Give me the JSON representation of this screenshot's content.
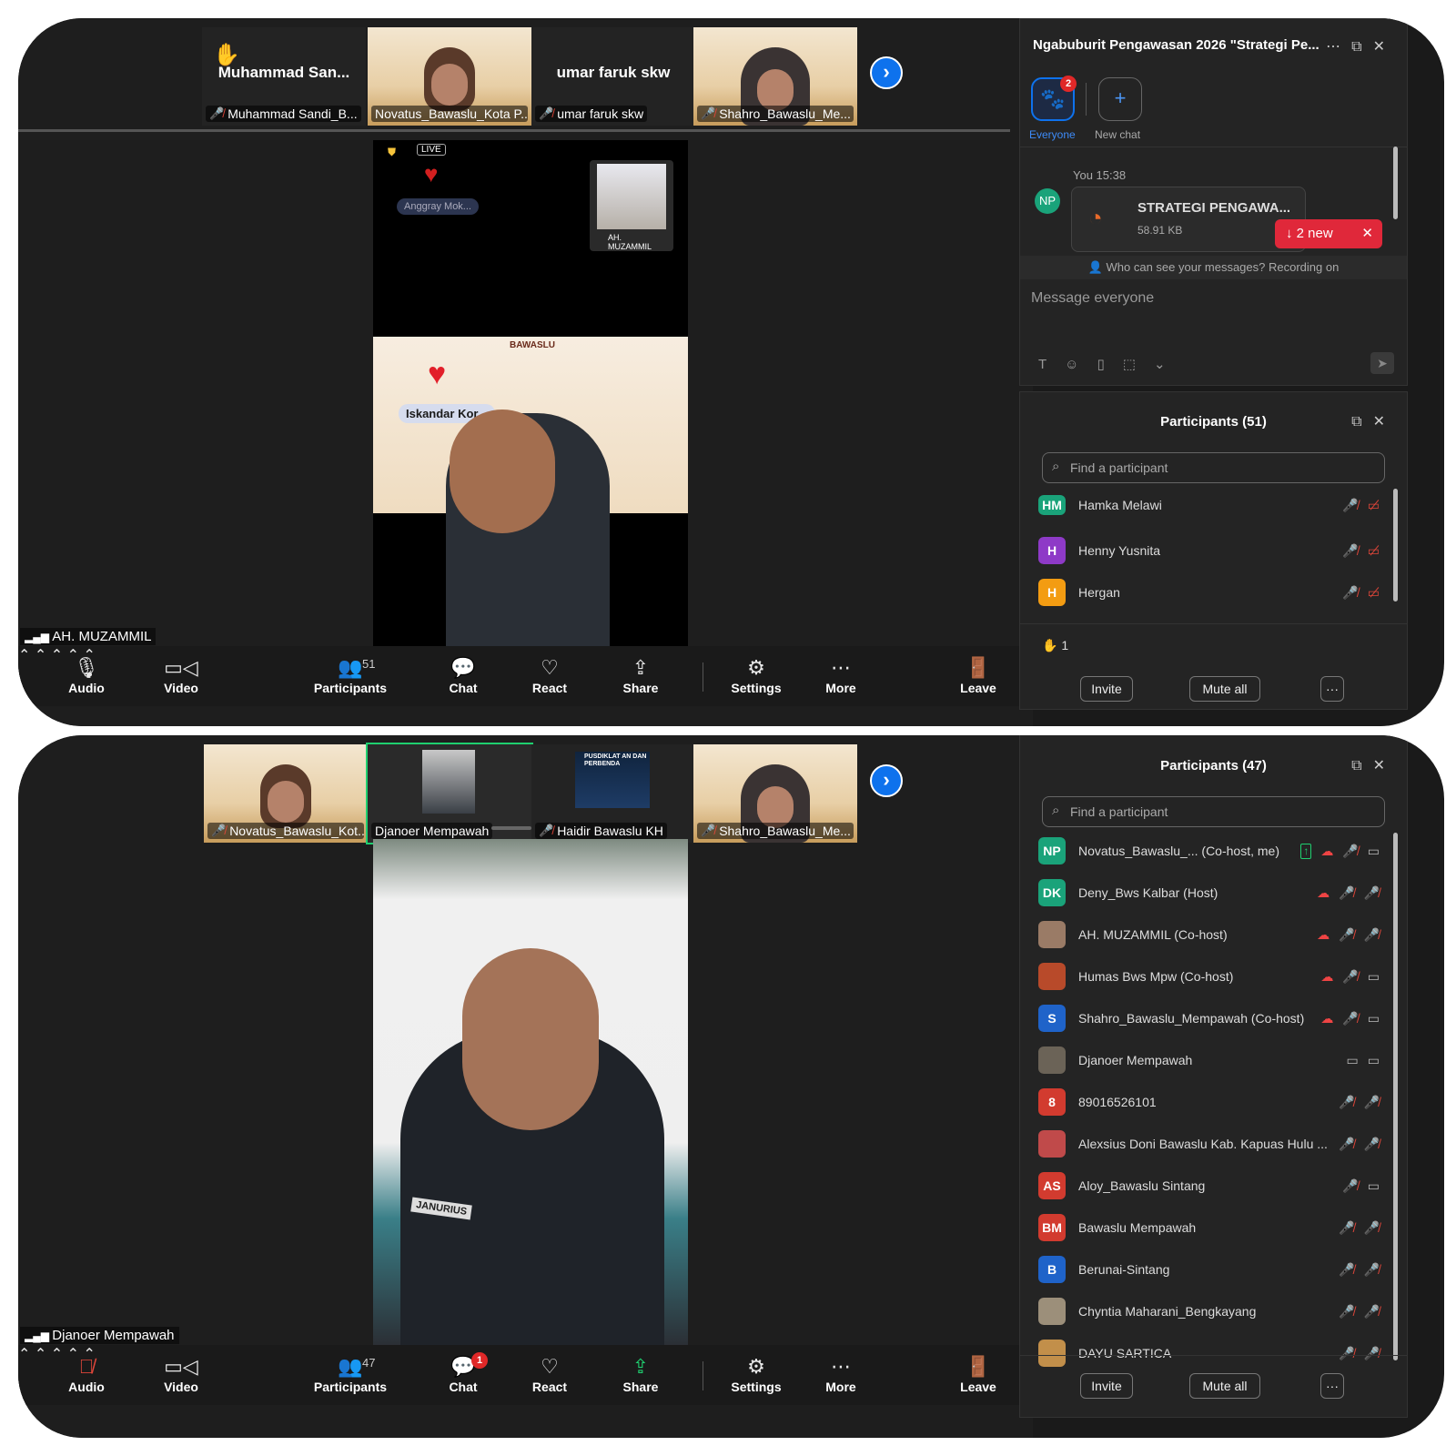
{
  "shot1": {
    "strip": {
      "tiles": [
        {
          "big": "Muhammad  San...",
          "name": "Muhammad Sandi_B..."
        },
        {
          "name": "Novatus_Bawaslu_Kota P..."
        },
        {
          "big": "umar faruk skw",
          "name": "umar faruk skw"
        },
        {
          "name": "Shahro_Bawaslu_Me..."
        }
      ],
      "hand_icon": "raised-hand-icon"
    },
    "main": {
      "live_badge": "LIVE",
      "commenter": "Anggray Mok...",
      "pip_name": "AH. MUZAMMIL",
      "overlay_name": "Iskandar Kor...",
      "brand": "BAWASLU",
      "speaker": "AH. MUZAMMIL"
    },
    "toolbar": {
      "audio": "Audio",
      "video": "Video",
      "participants": "Participants",
      "participants_count": "51",
      "chat": "Chat",
      "react": "React",
      "share": "Share",
      "settings": "Settings",
      "more": "More",
      "leave": "Leave"
    },
    "chat": {
      "title": "Ngabuburit Pengawasan 2026 \"Strategi Pe...",
      "tabs": [
        {
          "label": "Everyone",
          "badge": "2"
        },
        {
          "label": "New chat"
        }
      ],
      "sender_initials": "NP",
      "timestamp": "You 15:38",
      "file_name": "STRATEGI PENGAWA...",
      "file_size": "58.91 KB",
      "new_pill": "2 new",
      "notice": "Who can see your messages? Recording on",
      "placeholder": "Message everyone"
    },
    "participants": {
      "title": "Participants (51)",
      "search_placeholder": "Find a participant",
      "rows": [
        {
          "initials": "HM",
          "color": "#1aa37a",
          "name": "Hamka Melawi"
        },
        {
          "initials": "H",
          "color": "#8e3ac7",
          "name": "Henny Yusnita"
        },
        {
          "initials": "H",
          "color": "#f39c12",
          "name": "Hergan"
        }
      ],
      "raised_count": "1",
      "invite": "Invite",
      "mute_all": "Mute all",
      "more": "···"
    }
  },
  "shot2": {
    "strip": {
      "tiles": [
        {
          "name": "Novatus_Bawaslu_Kot..."
        },
        {
          "name": "Djanoer Mempawah"
        },
        {
          "name": "Haidir Bawaslu KH",
          "banner": "PUSDIKLAT AN DAN PERBENDA"
        },
        {
          "name": "Shahro_Bawaslu_Me..."
        }
      ]
    },
    "main": {
      "speaker": "Djanoer Mempawah",
      "badge_text": "JANURIUS"
    },
    "toolbar": {
      "audio": "Audio",
      "video": "Video",
      "participants": "Participants",
      "participants_count": "47",
      "chat": "Chat",
      "chat_badge": "1",
      "react": "React",
      "share": "Share",
      "settings": "Settings",
      "more": "More",
      "leave": "Leave"
    },
    "participants": {
      "title": "Participants (47)",
      "search_placeholder": "Find a participant",
      "rows": [
        {
          "initials": "NP",
          "color": "#1aa37a",
          "name": "Novatus_Bawaslu_...  (Co-host, me)"
        },
        {
          "initials": "DK",
          "color": "#1aa37a",
          "name": "Deny_Bws Kalbar (Host)"
        },
        {
          "initials": "",
          "color": "#9a7b66",
          "name": "AH. MUZAMMIL (Co-host)"
        },
        {
          "initials": "",
          "color": "#b84a2a",
          "name": "Humas Bws Mpw (Co-host)"
        },
        {
          "initials": "S",
          "color": "#1f63c9",
          "name": "Shahro_Bawaslu_Mempawah (Co-host)"
        },
        {
          "initials": "",
          "color": "#6b6357",
          "name": "Djanoer Mempawah"
        },
        {
          "initials": "8",
          "color": "#d23b2f",
          "name": "89016526101"
        },
        {
          "initials": "",
          "color": "#c04a4a",
          "name": "Alexsius Doni Bawaslu Kab. Kapuas Hulu ..."
        },
        {
          "initials": "AS",
          "color": "#d23b2f",
          "name": "Aloy_Bawaslu Sintang"
        },
        {
          "initials": "BM",
          "color": "#d23b2f",
          "name": "Bawaslu Mempawah"
        },
        {
          "initials": "B",
          "color": "#1f63c9",
          "name": "Berunai-Sintang"
        },
        {
          "initials": "",
          "color": "#9c8f7a",
          "name": "Chyntia Maharani_Bengkayang"
        },
        {
          "initials": "",
          "color": "#c28f4a",
          "name": "DAYU SARTICA"
        }
      ],
      "invite": "Invite",
      "mute_all": "Mute all",
      "more": "···"
    }
  }
}
